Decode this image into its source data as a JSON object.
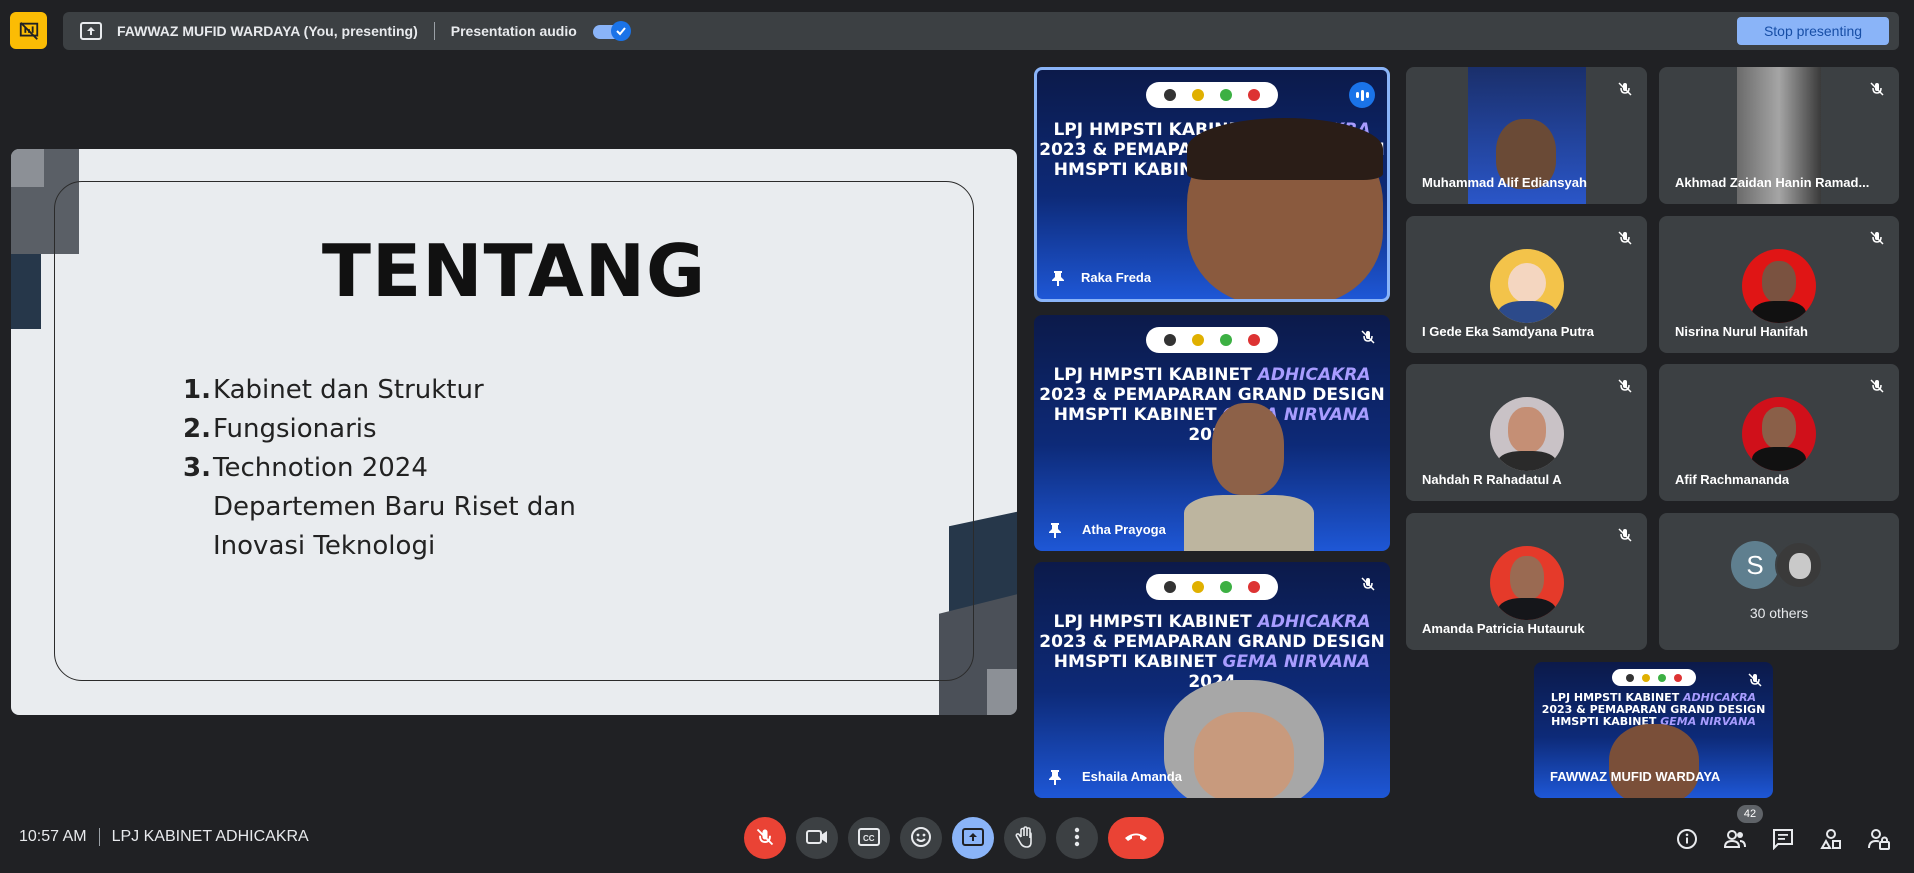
{
  "presentation_bar": {
    "presenter": "FAWWAZ MUFID WARDAYA (You, presenting)",
    "audio_label": "Presentation audio",
    "audio_enabled": true,
    "stop_label": "Stop presenting"
  },
  "slide": {
    "title": "TENTANG",
    "items": [
      {
        "num": "1.",
        "text": "Kabinet dan Struktur"
      },
      {
        "num": "2.",
        "text": "Fungsionaris"
      },
      {
        "num": "3.",
        "text": "Technotion 2024"
      },
      {
        "num": "",
        "text": "Departemen Baru Riset dan"
      },
      {
        "num": "",
        "text": "Inovasi Teknologi"
      }
    ]
  },
  "video_banner": {
    "line1_a": "LPJ HMPSTI KABINET ",
    "line1_b": "ADHICAKRA",
    "line2": "2023 & PEMAPARAN GRAND DESIGN",
    "line3_a": "HMSPTI KABINET ",
    "line3_b": "GEMA NIRVANA",
    "line3_c": " 2024"
  },
  "participants": {
    "raka": "Raka Freda",
    "atha": "Atha Prayoga",
    "eshaila": "Eshaila Amanda",
    "alif": "Muhammad Alif Ediansyah",
    "zaidan": "Akhmad Zaidan Hanin Ramad...",
    "gede": "I Gede Eka Samdyana Putra",
    "nisrina": "Nisrina Nurul Hanifah",
    "nahdah": "Nahdah R Rahadatul A",
    "afif": "Afif Rachmananda",
    "amanda": "Amanda Patricia Hutauruk",
    "others_initial": "S",
    "others_label": "30 others",
    "self": "FAWWAZ MUFID WARDAYA"
  },
  "footer": {
    "time": "10:57 AM",
    "meeting_name": "LPJ KABINET ADHICAKRA",
    "people_count": "42"
  },
  "colors": {
    "background": "#202124",
    "accent": "#8ab4f8",
    "danger": "#ea4335",
    "warning": "#fbbc04"
  },
  "icons": {
    "presentation_off": "presentation-off-icon",
    "present": "present-to-all-icon",
    "mic_off": "mic-off-icon",
    "camera": "camera-icon",
    "captions": "captions-icon",
    "emoji": "emoji-icon",
    "hand": "raise-hand-icon",
    "more": "more-vert-icon",
    "end_call": "end-call-icon",
    "info": "info-icon",
    "people": "people-icon",
    "chat": "chat-icon",
    "activities": "activities-icon",
    "host_controls": "lock-person-icon",
    "pin": "pin-icon"
  }
}
